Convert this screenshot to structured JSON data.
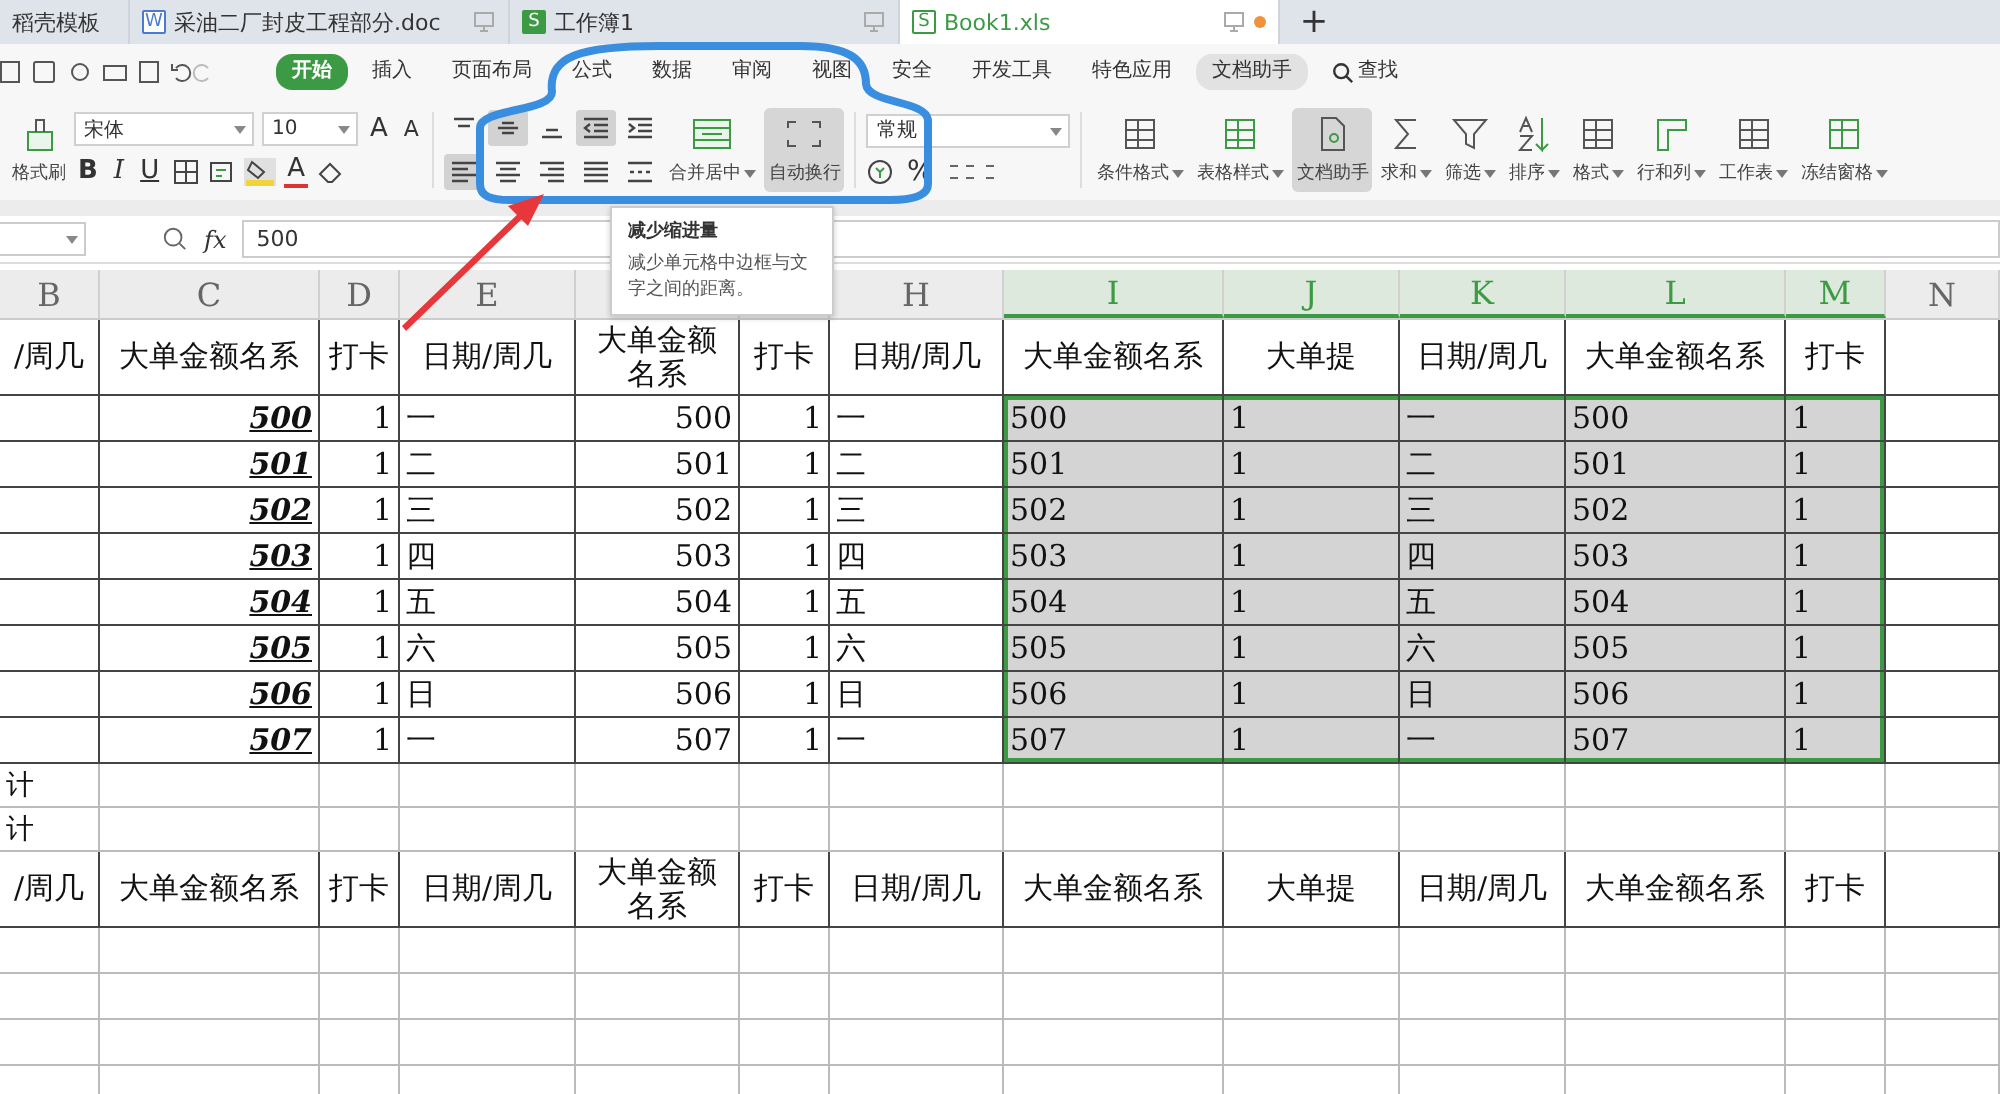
{
  "tabs": [
    {
      "label": "稻壳模板",
      "selected": false
    },
    {
      "label": "采油二厂封皮工程部分.doc",
      "kind": "doc",
      "badge": "W",
      "selected": false
    },
    {
      "label": "工作簿1",
      "kind": "sheet",
      "badge": "S",
      "selected": false
    },
    {
      "label": "Book1.xls",
      "kind": "sheet",
      "badge": "S",
      "selected": true
    }
  ],
  "new_tab": "+",
  "menu": [
    {
      "label": "开始",
      "selected": true
    },
    {
      "label": "插入",
      "selected": false
    },
    {
      "label": "页面布局",
      "selected": false
    },
    {
      "label": "公式",
      "selected": false
    },
    {
      "label": "数据",
      "selected": false
    },
    {
      "label": "审阅",
      "selected": false
    },
    {
      "label": "视图",
      "selected": false
    },
    {
      "label": "安全",
      "selected": false
    },
    {
      "label": "开发工具",
      "selected": false
    },
    {
      "label": "特色应用",
      "selected": false
    },
    {
      "label": "文档助手",
      "selected": false,
      "kind": "pill"
    },
    {
      "label": "查找",
      "kind": "search"
    }
  ],
  "ribbon": {
    "format_painter": "格式刷",
    "font_name": "宋体",
    "font_size": "10",
    "style_buttons": [
      {
        "label": "B",
        "kind": "bold"
      },
      {
        "label": "I",
        "kind": "italic"
      },
      {
        "label": "U",
        "kind": "underline"
      }
    ],
    "grow_font": "A",
    "shrink_font": "A",
    "font_color": "A",
    "align_buttons": [
      {
        "kind": "top",
        "pressed": false
      },
      {
        "kind": "middle",
        "pressed": true
      },
      {
        "kind": "bottom",
        "pressed": false
      },
      {
        "kind": "outdent",
        "pressed": true
      },
      {
        "kind": "indent",
        "pressed": false
      },
      {
        "kind": "left",
        "pressed": true
      },
      {
        "kind": "center",
        "pressed": false
      },
      {
        "kind": "right",
        "pressed": false
      },
      {
        "kind": "justify",
        "pressed": false
      },
      {
        "kind": "distribute",
        "pressed": false
      }
    ],
    "merge": "合并居中",
    "wrap": {
      "label": "自动换行",
      "pressed": true
    },
    "number_format": "常规",
    "percent": "%",
    "tools": [
      {
        "label": "条件格式",
        "kind": "grid",
        "pressed": false
      },
      {
        "label": "表格样式",
        "kind": "table",
        "pressed": false
      },
      {
        "label": "文档助手",
        "kind": "doc",
        "pressed": true
      },
      {
        "label": "求和",
        "kind": "sum",
        "pressed": false
      },
      {
        "label": "筛选",
        "kind": "filter",
        "pressed": false
      },
      {
        "label": "排序",
        "kind": "sort",
        "pressed": false
      },
      {
        "label": "格式",
        "kind": "format",
        "pressed": false
      },
      {
        "label": "行和列",
        "kind": "rowcol",
        "pressed": false
      },
      {
        "label": "工作表",
        "kind": "sheet",
        "pressed": false
      },
      {
        "label": "冻结窗格",
        "kind": "freeze",
        "pressed": false
      }
    ]
  },
  "tooltip": {
    "title": "减少缩进量",
    "text": "减少单元格中边框与文字之间的距离。"
  },
  "formula_bar": {
    "fx": "fx",
    "value": "500"
  },
  "columns": [
    {
      "letter": "B",
      "selected": false
    },
    {
      "letter": "C",
      "selected": false
    },
    {
      "letter": "D",
      "selected": false
    },
    {
      "letter": "E",
      "selected": false
    },
    {},
    {},
    {
      "letter": "H",
      "selected": false
    },
    {
      "letter": "I",
      "selected": true
    },
    {
      "letter": "J",
      "selected": true
    },
    {
      "letter": "K",
      "selected": true
    },
    {
      "letter": "L",
      "selected": true
    },
    {
      "letter": "M",
      "selected": true
    },
    {
      "letter": "N",
      "selected": false
    }
  ],
  "rows": [
    {
      "kind": "header",
      "selected": false,
      "cells": [
        "/周几",
        "大单金额名系",
        "打卡",
        "日期/周几",
        "大单金额名系",
        "打卡",
        "日期/周几",
        "大单金额名系",
        "大单提",
        "日期/周几",
        "大单金额名系",
        "打卡",
        null
      ]
    },
    {
      "kind": "data",
      "selected": true,
      "cells": [
        null,
        "500",
        "1",
        "一",
        "500",
        "1",
        "一",
        "500",
        "1",
        "一",
        "500",
        "1",
        null
      ]
    },
    {
      "kind": "data",
      "selected": true,
      "cells": [
        null,
        "501",
        "1",
        "二",
        "501",
        "1",
        "二",
        "501",
        "1",
        "二",
        "501",
        "1",
        null
      ]
    },
    {
      "kind": "data",
      "selected": true,
      "cells": [
        null,
        "502",
        "1",
        "三",
        "502",
        "1",
        "三",
        "502",
        "1",
        "三",
        "502",
        "1",
        null
      ]
    },
    {
      "kind": "data",
      "selected": true,
      "cells": [
        null,
        "503",
        "1",
        "四",
        "503",
        "1",
        "四",
        "503",
        "1",
        "四",
        "503",
        "1",
        null
      ]
    },
    {
      "kind": "data",
      "selected": true,
      "cells": [
        null,
        "504",
        "1",
        "五",
        "504",
        "1",
        "五",
        "504",
        "1",
        "五",
        "504",
        "1",
        null
      ]
    },
    {
      "kind": "data",
      "selected": true,
      "cells": [
        null,
        "505",
        "1",
        "六",
        "505",
        "1",
        "六",
        "505",
        "1",
        "六",
        "505",
        "1",
        null
      ]
    },
    {
      "kind": "data",
      "selected": true,
      "cells": [
        null,
        "506",
        "1",
        "日",
        "506",
        "1",
        "日",
        "506",
        "1",
        "日",
        "506",
        "1",
        null
      ]
    },
    {
      "kind": "data",
      "selected": true,
      "cells": [
        null,
        "507",
        "1",
        "一",
        "507",
        "1",
        "一",
        "507",
        "1",
        "一",
        "507",
        "1",
        null
      ]
    },
    {
      "kind": "total",
      "selected": false,
      "cells": [
        "计",
        null,
        null,
        null,
        null,
        null,
        null,
        null,
        null,
        null,
        null,
        null,
        null
      ]
    },
    {
      "kind": "total",
      "selected": false,
      "cells": [
        "计",
        null,
        null,
        null,
        null,
        null,
        null,
        null,
        null,
        null,
        null,
        null,
        null
      ]
    },
    {
      "kind": "header",
      "selected": false,
      "cells": [
        "/周几",
        "大单金额名系",
        "打卡",
        "日期/周几",
        "大单金额名系",
        "打卡",
        "日期/周几",
        "大单金额名系",
        "大单提",
        "日期/周几",
        "大单金额名系",
        "打卡",
        null
      ]
    },
    {
      "kind": "blank",
      "selected": false,
      "cells": []
    },
    {
      "kind": "blank",
      "selected": false,
      "cells": []
    },
    {
      "kind": "blank",
      "selected": false,
      "cells": []
    },
    {
      "kind": "blank",
      "selected": false,
      "cells": []
    }
  ]
}
